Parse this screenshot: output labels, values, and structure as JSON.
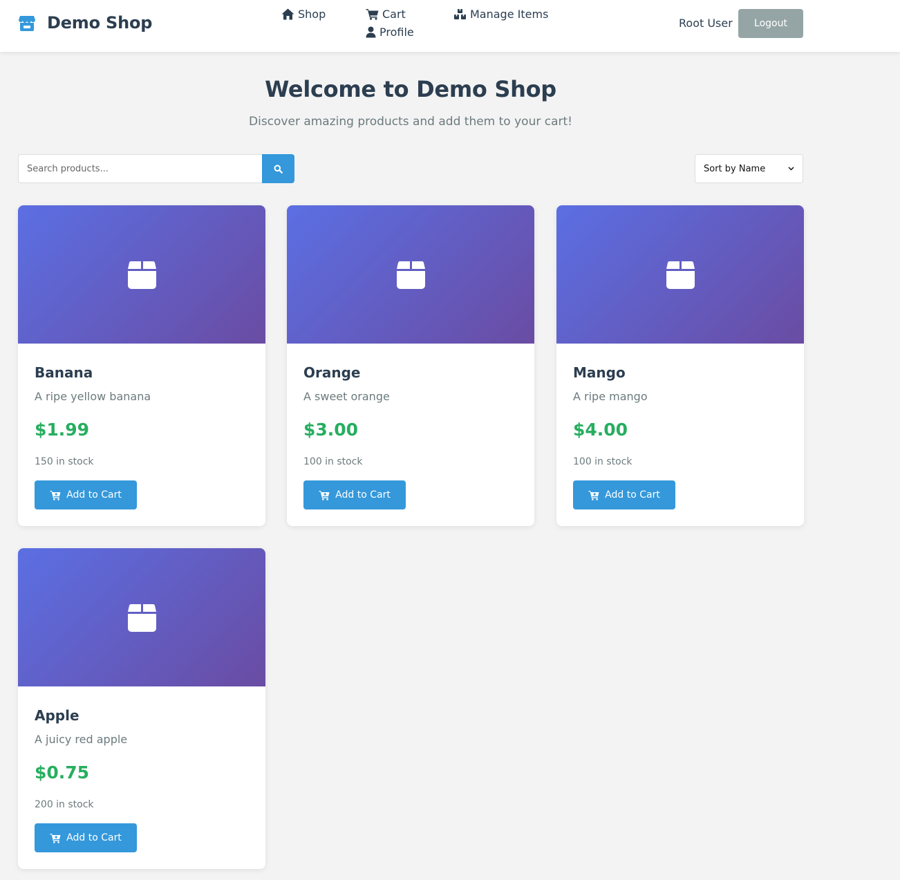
{
  "navbar": {
    "brand": "Demo Shop",
    "links": {
      "shop": "Shop",
      "cart": "Cart",
      "manage": "Manage Items",
      "profile": "Profile"
    },
    "user": "Root User",
    "logout": "Logout"
  },
  "hero": {
    "title": "Welcome to Demo Shop",
    "subtitle": "Discover amazing products and add them to your cart!"
  },
  "search": {
    "placeholder": "Search products...",
    "value": ""
  },
  "sort": {
    "selected": "Sort by Name"
  },
  "products": [
    {
      "name": "Banana",
      "description": "A ripe yellow banana",
      "price": "$1.99",
      "stock": "150 in stock",
      "button": "Add to Cart"
    },
    {
      "name": "Orange",
      "description": "A sweet orange",
      "price": "$3.00",
      "stock": "100 in stock",
      "button": "Add to Cart"
    },
    {
      "name": "Mango",
      "description": "A ripe mango",
      "price": "$4.00",
      "stock": "100 in stock",
      "button": "Add to Cart"
    },
    {
      "name": "Apple",
      "description": "A juicy red apple",
      "price": "$0.75",
      "stock": "200 in stock",
      "button": "Add to Cart"
    }
  ],
  "colors": {
    "primary": "#3498db",
    "price": "#27ae60",
    "logout": "#95a5a6",
    "gradient_start": "#5b6fe3",
    "gradient_end": "#6a4ca3"
  },
  "icons": {
    "brand": "store-icon",
    "shop": "home-icon",
    "cart": "cart-icon",
    "manage": "boxes-icon",
    "profile": "user-icon",
    "search": "search-icon",
    "product": "box-icon",
    "add": "cart-plus-icon"
  }
}
